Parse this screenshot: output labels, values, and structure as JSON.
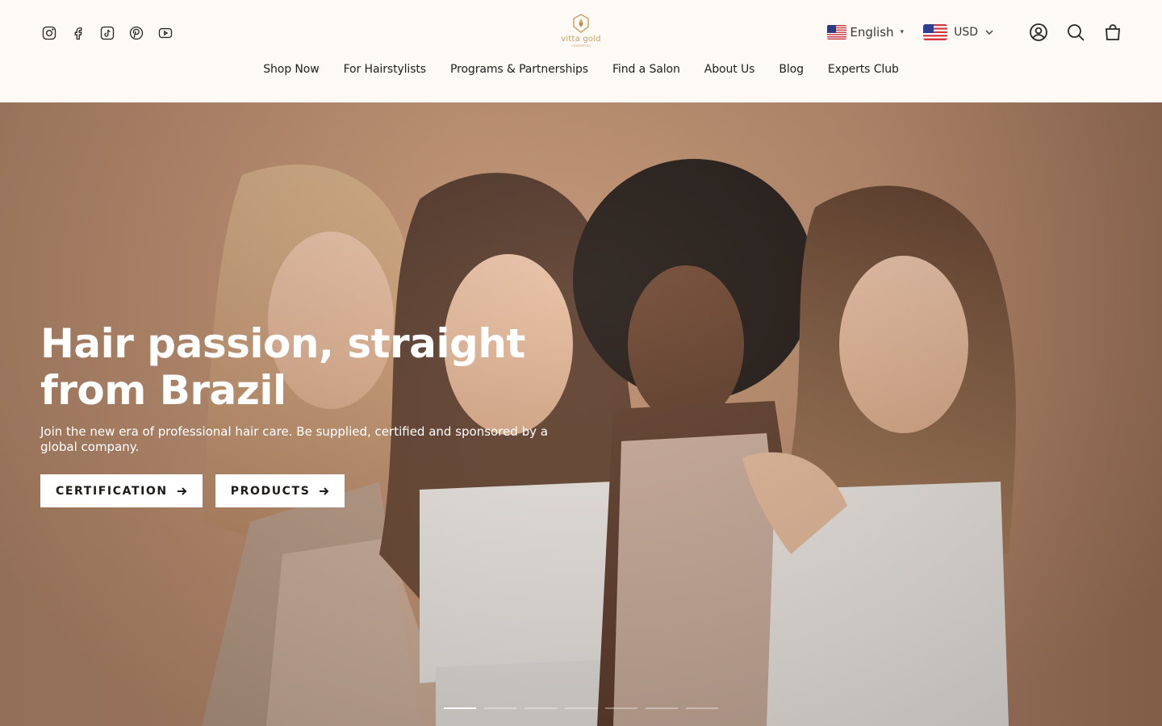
{
  "header": {
    "social": [
      {
        "name": "instagram-icon"
      },
      {
        "name": "facebook-icon"
      },
      {
        "name": "tiktok-icon"
      },
      {
        "name": "pinterest-icon"
      },
      {
        "name": "youtube-icon"
      }
    ],
    "logo": {
      "text": "vitta gold",
      "sub": "cosmetics"
    },
    "language": {
      "label": "English",
      "caret": "▾",
      "flag": "us-flag"
    },
    "currency": {
      "label": "USD",
      "flag": "us-flag"
    },
    "tools": [
      "account-icon",
      "search-icon",
      "cart-icon"
    ]
  },
  "nav": {
    "items": [
      "Shop Now",
      "For Hairstylists",
      "Programs & Partnerships",
      "Find a Salon",
      "About Us",
      "Blog",
      "Experts Club"
    ]
  },
  "hero": {
    "title": "Hair passion, straight from Brazil",
    "subtitle": "Join the new era of professional hair care. Be supplied, certified and sponsored by a global company.",
    "buttons": [
      "CERTIFICATION",
      "PRODUCTS"
    ],
    "slides_count": 7,
    "active_slide": 1
  },
  "colors": {
    "header_bg": "#fdf9f5",
    "hero_bg": "#bf9070",
    "accent_gold": "#c59e63",
    "text_dark": "#1d1a17"
  }
}
